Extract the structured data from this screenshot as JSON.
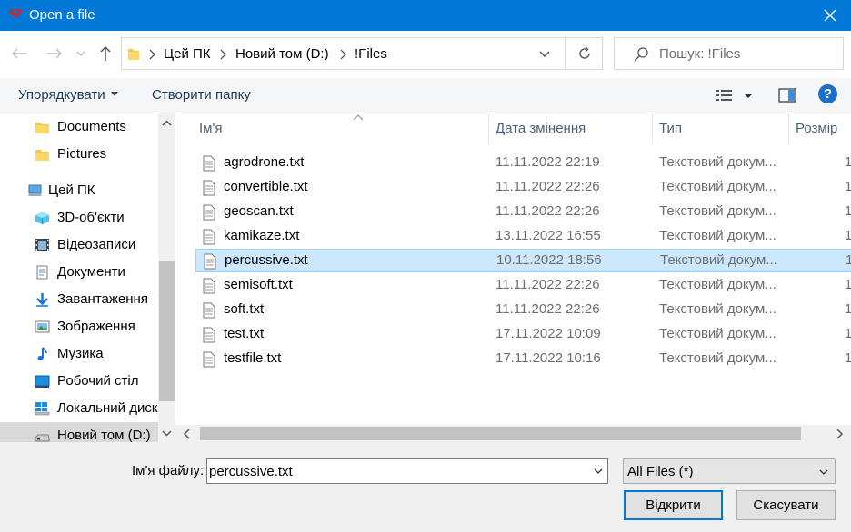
{
  "window": {
    "title": "Open a file"
  },
  "address": {
    "crumbs": [
      "Цей ПК",
      "Новий том (D:)",
      "!Files"
    ],
    "search_placeholder": "Пошук: !Files"
  },
  "commands": {
    "organize": "Упорядкувати",
    "new_folder": "Створити папку"
  },
  "nav": {
    "items": [
      {
        "label": "Documents",
        "icon": "folder-icon"
      },
      {
        "label": "Pictures",
        "icon": "folder-icon"
      },
      {
        "label": "Цей ПК",
        "icon": "pc-icon"
      },
      {
        "label": "3D-об'єкти",
        "icon": "3d-objects-icon"
      },
      {
        "label": "Відеозаписи",
        "icon": "video-icon"
      },
      {
        "label": "Документи",
        "icon": "documents-icon"
      },
      {
        "label": "Завантаження",
        "icon": "download-icon"
      },
      {
        "label": "Зображення",
        "icon": "pictures-icon"
      },
      {
        "label": "Музика",
        "icon": "music-icon"
      },
      {
        "label": "Робочий стіл",
        "icon": "desktop-icon"
      },
      {
        "label": "Локальний диск",
        "icon": "windows-drive-icon"
      },
      {
        "label": "Новий том (D:)",
        "icon": "drive-icon",
        "selected": true
      }
    ]
  },
  "columns": {
    "name": "Ім'я",
    "date": "Дата змінення",
    "type": "Тип",
    "size": "Розмір"
  },
  "files": [
    {
      "name": "agrodrone.txt",
      "date": "11.11.2022 22:19",
      "type": "Текстовий докум...",
      "size": "1"
    },
    {
      "name": "convertible.txt",
      "date": "11.11.2022 22:26",
      "type": "Текстовий докум...",
      "size": "1"
    },
    {
      "name": "geoscan.txt",
      "date": "11.11.2022 22:26",
      "type": "Текстовий докум...",
      "size": "1"
    },
    {
      "name": "kamikaze.txt",
      "date": "13.11.2022 16:55",
      "type": "Текстовий докум...",
      "size": "1"
    },
    {
      "name": "percussive.txt",
      "date": "10.11.2022 18:56",
      "type": "Текстовий докум...",
      "size": "1",
      "selected": true
    },
    {
      "name": "semisoft.txt",
      "date": "11.11.2022 22:26",
      "type": "Текстовий докум...",
      "size": "1"
    },
    {
      "name": "soft.txt",
      "date": "11.11.2022 22:26",
      "type": "Текстовий докум...",
      "size": "1"
    },
    {
      "name": "test.txt",
      "date": "17.11.2022 10:09",
      "type": "Текстовий докум...",
      "size": "1"
    },
    {
      "name": "testfile.txt",
      "date": "17.11.2022 10:16",
      "type": "Текстовий докум...",
      "size": "1"
    }
  ],
  "bottom": {
    "filename_label": "Ім'я файлу:",
    "filename_value": "percussive.txt",
    "filetype": "All Files (*)",
    "open_label": "Відкрити",
    "cancel_label": "Скасувати"
  },
  "colors": {
    "titlebar": "#0078d7",
    "selection": "#cce8ff",
    "accent": "#0078d7"
  }
}
